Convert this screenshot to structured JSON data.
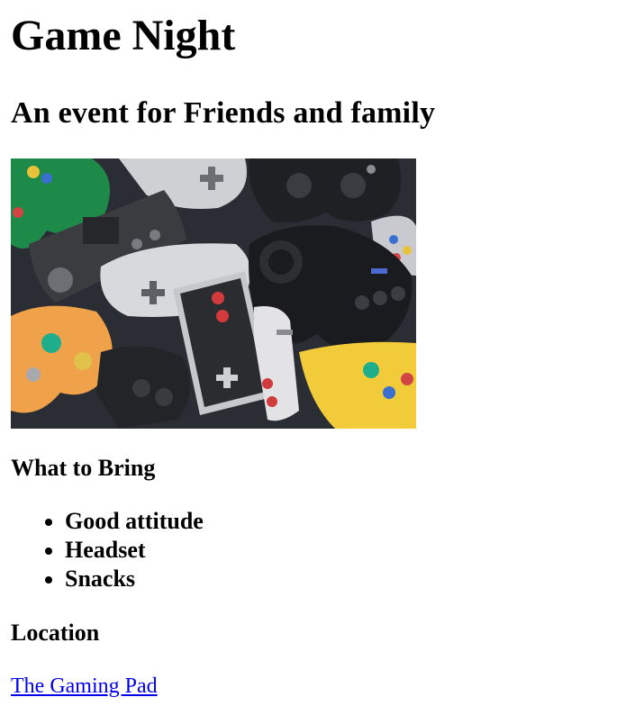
{
  "event": {
    "title": "Game Night",
    "subtitle": "An event for Friends and family"
  },
  "bring": {
    "heading": "What to Bring",
    "items": [
      "Good attitude",
      "Headset",
      "Snacks"
    ]
  },
  "location": {
    "heading": "Location",
    "link_text": "The Gaming Pad"
  },
  "colors": {
    "link": "#0000ee",
    "text": "#000000",
    "background": "#ffffff"
  }
}
